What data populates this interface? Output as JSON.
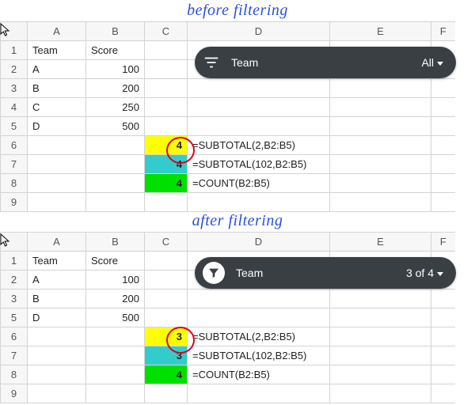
{
  "captions": {
    "before": "before filtering",
    "after": "after filtering"
  },
  "columns": [
    "A",
    "B",
    "C",
    "D",
    "E",
    "F"
  ],
  "headers": {
    "team": "Team",
    "score": "Score"
  },
  "before": {
    "rows": [
      {
        "n": "1"
      },
      {
        "n": "2",
        "team": "A",
        "score": "100"
      },
      {
        "n": "3",
        "team": "B",
        "score": "200"
      },
      {
        "n": "4",
        "team": "C",
        "score": "250"
      },
      {
        "n": "5",
        "team": "D",
        "score": "500"
      },
      {
        "n": "6",
        "cval": "4",
        "formula": "=SUBTOTAL(2,B2:B5)"
      },
      {
        "n": "7",
        "cval": "4",
        "formula": "=SUBTOTAL(102,B2:B5)"
      },
      {
        "n": "8",
        "cval": "4",
        "formula": "=COUNT(B2:B5)"
      },
      {
        "n": "9"
      }
    ],
    "filter": {
      "field": "Team",
      "value": "All"
    }
  },
  "after": {
    "rows": [
      {
        "n": "1"
      },
      {
        "n": "2",
        "team": "A",
        "score": "100"
      },
      {
        "n": "3",
        "team": "B",
        "score": "200"
      },
      {
        "n": "5",
        "team": "D",
        "score": "500"
      },
      {
        "n": "6",
        "cval": "3",
        "formula": "=SUBTOTAL(2,B2:B5)"
      },
      {
        "n": "7",
        "cval": "3",
        "formula": "=SUBTOTAL(102,B2:B5)"
      },
      {
        "n": "8",
        "cval": "4",
        "formula": "=COUNT(B2:B5)"
      },
      {
        "n": "9"
      }
    ],
    "filter": {
      "field": "Team",
      "value": "3 of 4"
    }
  },
  "chart_data": {
    "type": "table",
    "title": "SUBTOTAL vs COUNT before and after a filter is applied",
    "data_before_filter": [
      {
        "Team": "A",
        "Score": 100
      },
      {
        "Team": "B",
        "Score": 200
      },
      {
        "Team": "C",
        "Score": 250
      },
      {
        "Team": "D",
        "Score": 500
      }
    ],
    "results_before_filter": {
      "SUBTOTAL(2,B2:B5)": 4,
      "SUBTOTAL(102,B2:B5)": 4,
      "COUNT(B2:B5)": 4
    },
    "results_after_filter_hide_C": {
      "SUBTOTAL(2,B2:B5)": 3,
      "SUBTOTAL(102,B2:B5)": 3,
      "COUNT(B2:B5)": 4
    },
    "filter": {
      "field": "Team",
      "hidden": [
        "C"
      ],
      "visible_count": "3 of 4"
    }
  }
}
